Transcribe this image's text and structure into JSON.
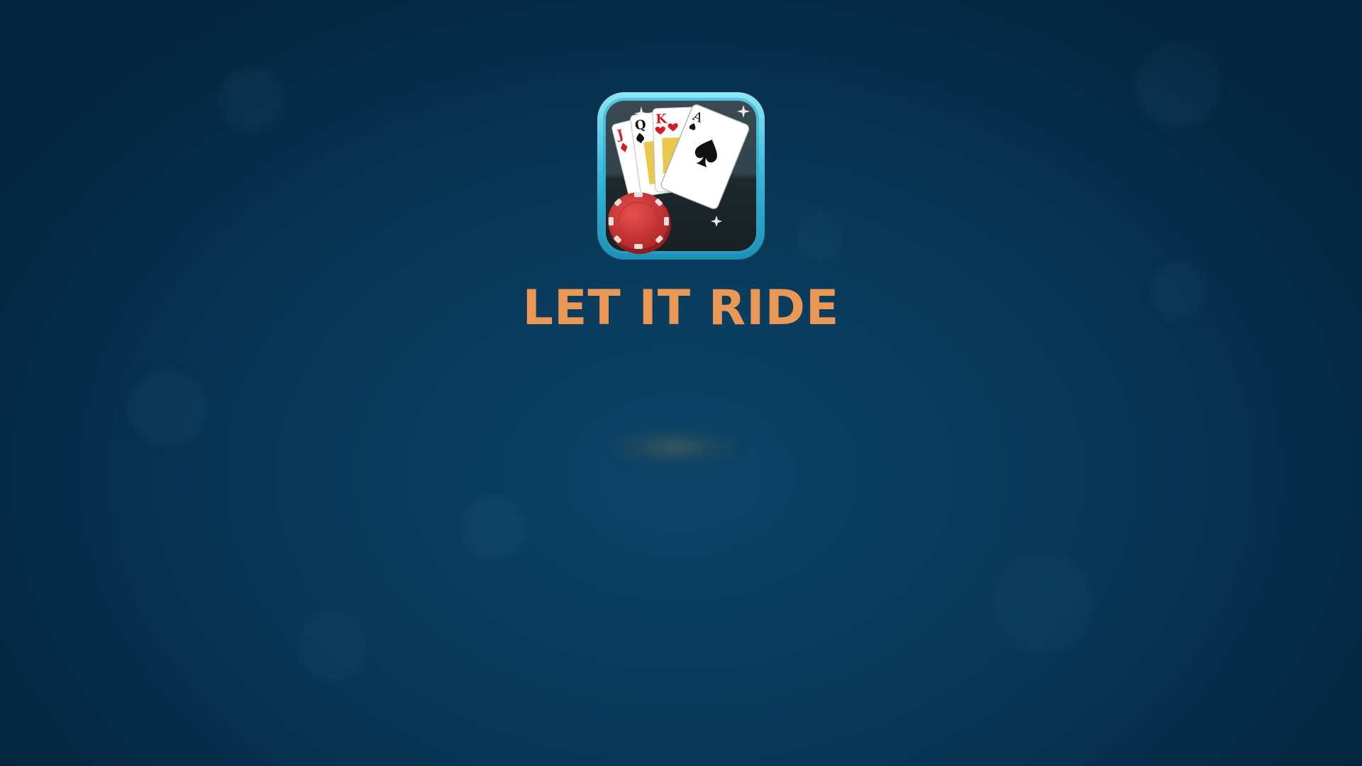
{
  "game": {
    "title": "LET IT RIDE",
    "icon": "playing-cards-and-chip-icon"
  },
  "icon_cards": [
    {
      "rank": "J",
      "suit": "diamond"
    },
    {
      "rank": "Q",
      "suit": "spade"
    },
    {
      "rank": "K",
      "suit": "heart"
    },
    {
      "rank": "A",
      "suit": "spade"
    }
  ],
  "colors": {
    "background": "#0a3d5f",
    "title": "#eb9856",
    "icon_frame": "#45c6e0",
    "chip": "#d23a3a"
  }
}
